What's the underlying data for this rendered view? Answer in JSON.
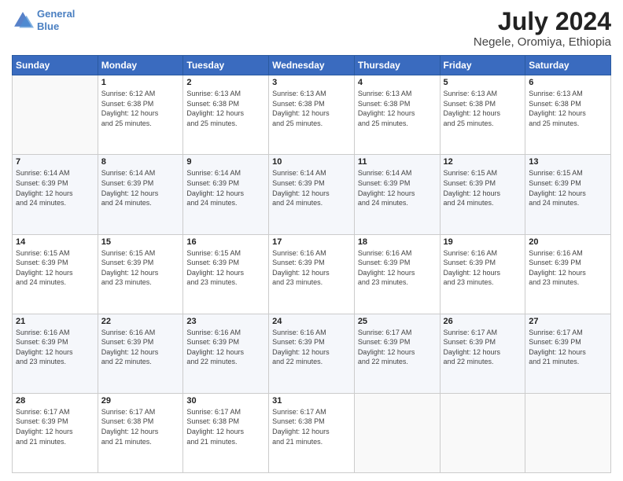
{
  "header": {
    "logo_line1": "General",
    "logo_line2": "Blue",
    "month_year": "July 2024",
    "location": "Negele, Oromiya, Ethiopia"
  },
  "days_of_week": [
    "Sunday",
    "Monday",
    "Tuesday",
    "Wednesday",
    "Thursday",
    "Friday",
    "Saturday"
  ],
  "weeks": [
    [
      {
        "num": "",
        "info": ""
      },
      {
        "num": "1",
        "info": "Sunrise: 6:12 AM\nSunset: 6:38 PM\nDaylight: 12 hours\nand 25 minutes."
      },
      {
        "num": "2",
        "info": "Sunrise: 6:13 AM\nSunset: 6:38 PM\nDaylight: 12 hours\nand 25 minutes."
      },
      {
        "num": "3",
        "info": "Sunrise: 6:13 AM\nSunset: 6:38 PM\nDaylight: 12 hours\nand 25 minutes."
      },
      {
        "num": "4",
        "info": "Sunrise: 6:13 AM\nSunset: 6:38 PM\nDaylight: 12 hours\nand 25 minutes."
      },
      {
        "num": "5",
        "info": "Sunrise: 6:13 AM\nSunset: 6:38 PM\nDaylight: 12 hours\nand 25 minutes."
      },
      {
        "num": "6",
        "info": "Sunrise: 6:13 AM\nSunset: 6:38 PM\nDaylight: 12 hours\nand 25 minutes."
      }
    ],
    [
      {
        "num": "7",
        "info": "Sunrise: 6:14 AM\nSunset: 6:39 PM\nDaylight: 12 hours\nand 24 minutes."
      },
      {
        "num": "8",
        "info": "Sunrise: 6:14 AM\nSunset: 6:39 PM\nDaylight: 12 hours\nand 24 minutes."
      },
      {
        "num": "9",
        "info": "Sunrise: 6:14 AM\nSunset: 6:39 PM\nDaylight: 12 hours\nand 24 minutes."
      },
      {
        "num": "10",
        "info": "Sunrise: 6:14 AM\nSunset: 6:39 PM\nDaylight: 12 hours\nand 24 minutes."
      },
      {
        "num": "11",
        "info": "Sunrise: 6:14 AM\nSunset: 6:39 PM\nDaylight: 12 hours\nand 24 minutes."
      },
      {
        "num": "12",
        "info": "Sunrise: 6:15 AM\nSunset: 6:39 PM\nDaylight: 12 hours\nand 24 minutes."
      },
      {
        "num": "13",
        "info": "Sunrise: 6:15 AM\nSunset: 6:39 PM\nDaylight: 12 hours\nand 24 minutes."
      }
    ],
    [
      {
        "num": "14",
        "info": "Sunrise: 6:15 AM\nSunset: 6:39 PM\nDaylight: 12 hours\nand 24 minutes."
      },
      {
        "num": "15",
        "info": "Sunrise: 6:15 AM\nSunset: 6:39 PM\nDaylight: 12 hours\nand 23 minutes."
      },
      {
        "num": "16",
        "info": "Sunrise: 6:15 AM\nSunset: 6:39 PM\nDaylight: 12 hours\nand 23 minutes."
      },
      {
        "num": "17",
        "info": "Sunrise: 6:16 AM\nSunset: 6:39 PM\nDaylight: 12 hours\nand 23 minutes."
      },
      {
        "num": "18",
        "info": "Sunrise: 6:16 AM\nSunset: 6:39 PM\nDaylight: 12 hours\nand 23 minutes."
      },
      {
        "num": "19",
        "info": "Sunrise: 6:16 AM\nSunset: 6:39 PM\nDaylight: 12 hours\nand 23 minutes."
      },
      {
        "num": "20",
        "info": "Sunrise: 6:16 AM\nSunset: 6:39 PM\nDaylight: 12 hours\nand 23 minutes."
      }
    ],
    [
      {
        "num": "21",
        "info": "Sunrise: 6:16 AM\nSunset: 6:39 PM\nDaylight: 12 hours\nand 23 minutes."
      },
      {
        "num": "22",
        "info": "Sunrise: 6:16 AM\nSunset: 6:39 PM\nDaylight: 12 hours\nand 22 minutes."
      },
      {
        "num": "23",
        "info": "Sunrise: 6:16 AM\nSunset: 6:39 PM\nDaylight: 12 hours\nand 22 minutes."
      },
      {
        "num": "24",
        "info": "Sunrise: 6:16 AM\nSunset: 6:39 PM\nDaylight: 12 hours\nand 22 minutes."
      },
      {
        "num": "25",
        "info": "Sunrise: 6:17 AM\nSunset: 6:39 PM\nDaylight: 12 hours\nand 22 minutes."
      },
      {
        "num": "26",
        "info": "Sunrise: 6:17 AM\nSunset: 6:39 PM\nDaylight: 12 hours\nand 22 minutes."
      },
      {
        "num": "27",
        "info": "Sunrise: 6:17 AM\nSunset: 6:39 PM\nDaylight: 12 hours\nand 21 minutes."
      }
    ],
    [
      {
        "num": "28",
        "info": "Sunrise: 6:17 AM\nSunset: 6:39 PM\nDaylight: 12 hours\nand 21 minutes."
      },
      {
        "num": "29",
        "info": "Sunrise: 6:17 AM\nSunset: 6:38 PM\nDaylight: 12 hours\nand 21 minutes."
      },
      {
        "num": "30",
        "info": "Sunrise: 6:17 AM\nSunset: 6:38 PM\nDaylight: 12 hours\nand 21 minutes."
      },
      {
        "num": "31",
        "info": "Sunrise: 6:17 AM\nSunset: 6:38 PM\nDaylight: 12 hours\nand 21 minutes."
      },
      {
        "num": "",
        "info": ""
      },
      {
        "num": "",
        "info": ""
      },
      {
        "num": "",
        "info": ""
      }
    ]
  ]
}
